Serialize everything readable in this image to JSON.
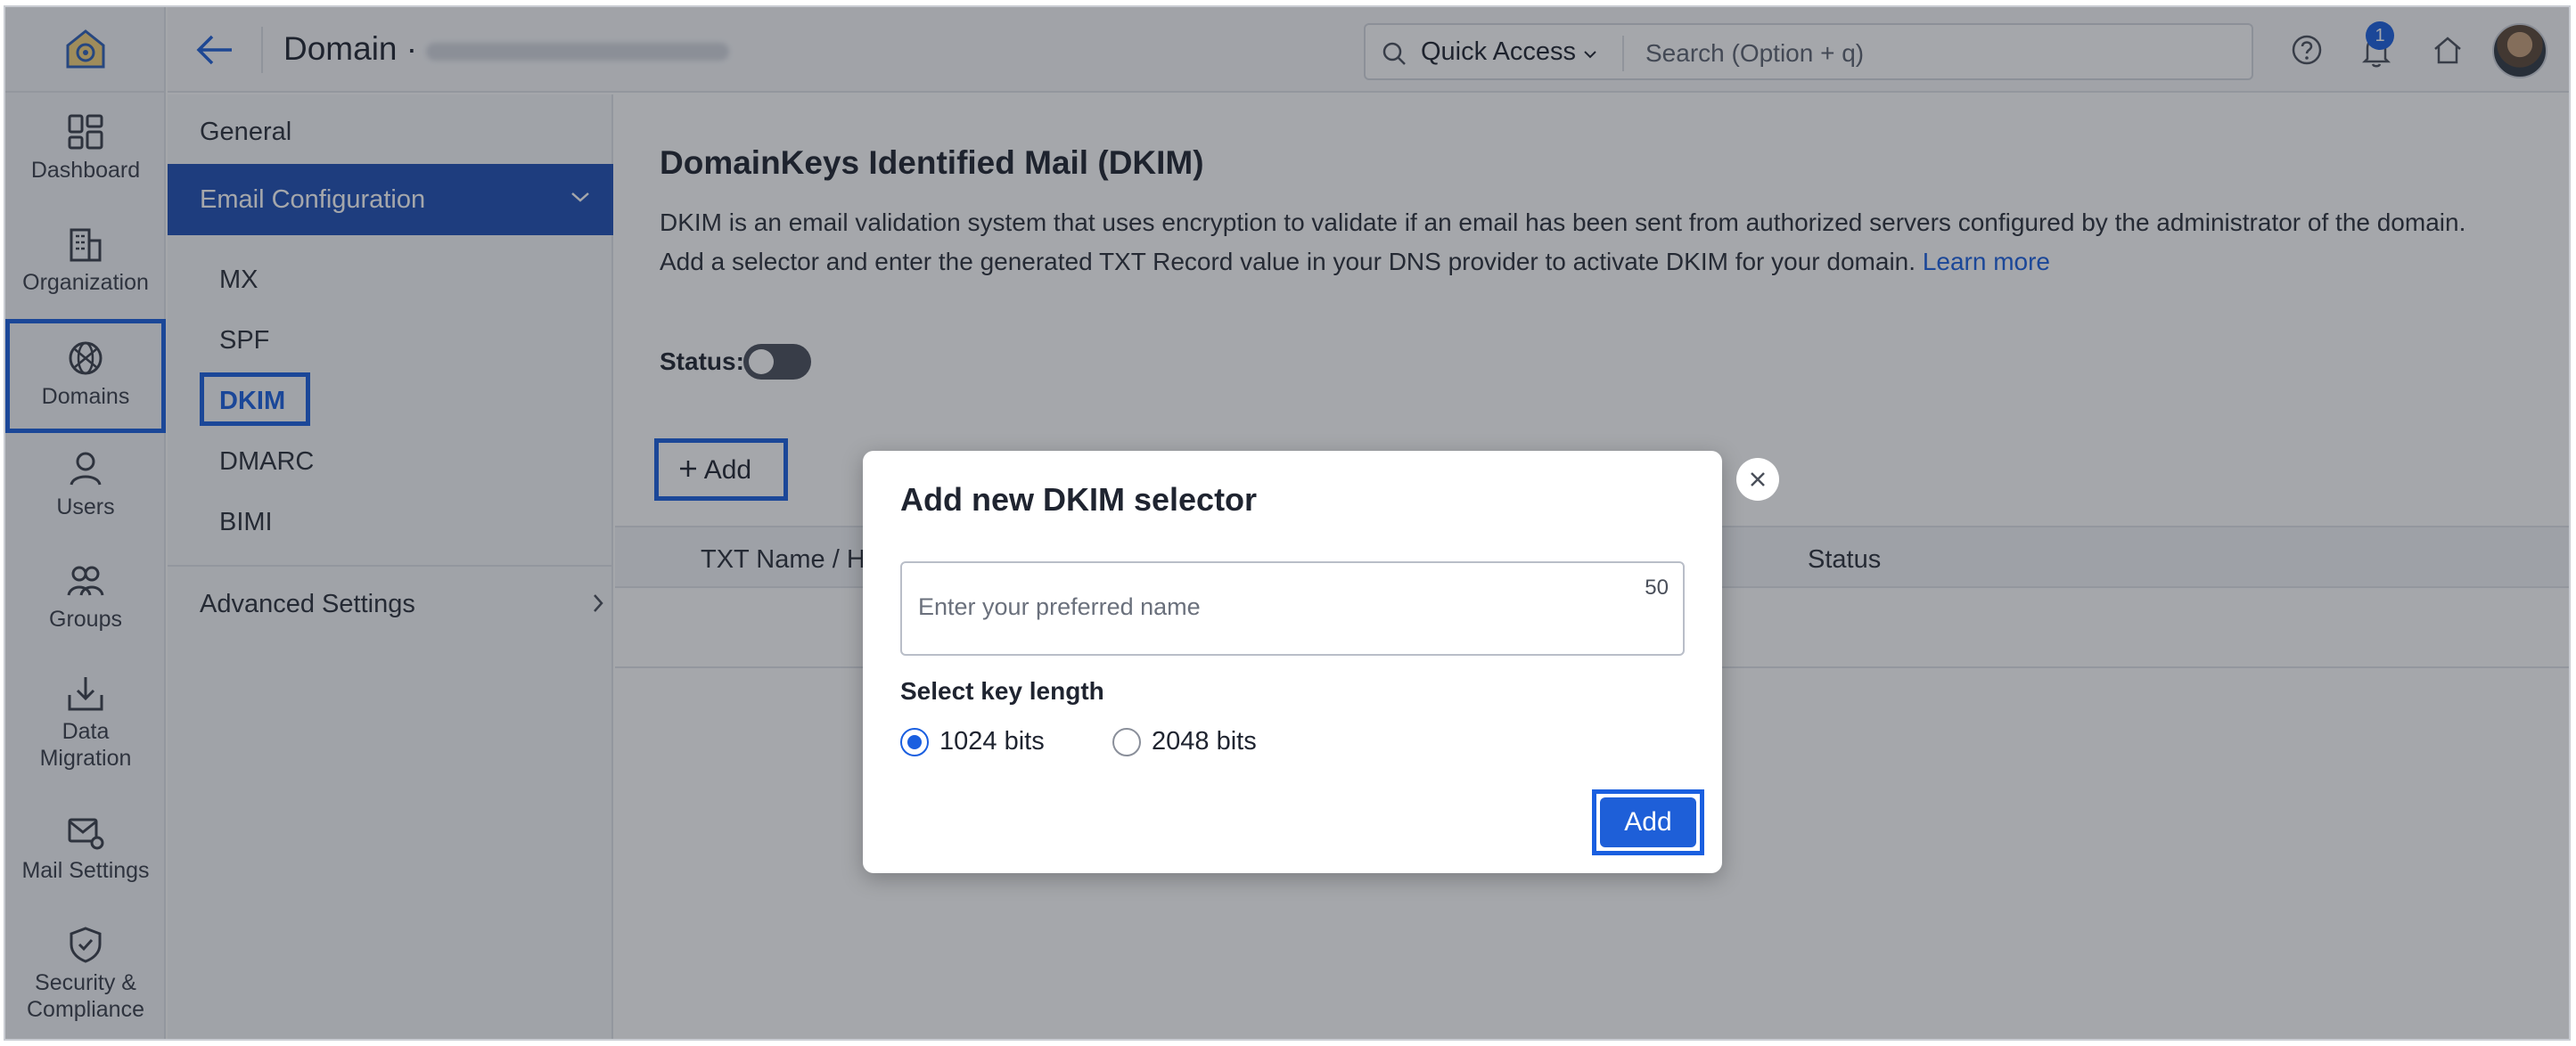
{
  "rail": {
    "items": [
      {
        "label": "Dashboard"
      },
      {
        "label": "Organization"
      },
      {
        "label": "Domains"
      },
      {
        "label": "Users"
      },
      {
        "label": "Groups"
      },
      {
        "label": "Data Migration"
      },
      {
        "label": "Mail Settings"
      },
      {
        "label": "Security & Compliance"
      }
    ]
  },
  "topbar": {
    "title": "Domain ·",
    "quick_access": "Quick Access",
    "search_placeholder": "Search (Option + q)",
    "notification_count": "1"
  },
  "subnav": {
    "general": "General",
    "email_configuration": "Email Configuration",
    "children": [
      "MX",
      "SPF",
      "DKIM",
      "DMARC",
      "BIMI"
    ],
    "advanced_settings": "Advanced Settings"
  },
  "main": {
    "title": "DomainKeys Identified Mail (DKIM)",
    "desc_line1": "DKIM is an email validation system that uses encryption to validate if an email has been sent from authorized servers configured by the administrator of the domain.",
    "desc_line2": "Add a selector and enter the generated TXT Record value in your DNS provider to activate DKIM for your domain.",
    "learn_more": "Learn more",
    "status_label": "Status:",
    "add_label": "Add",
    "col_txt_name": "TXT Name / H",
    "col_status": "Status"
  },
  "modal": {
    "title": "Add new DKIM selector",
    "input_placeholder": "Enter your preferred name",
    "char_limit": "50",
    "key_length_label": "Select key length",
    "options": [
      {
        "label": "1024 bits",
        "selected": true
      },
      {
        "label": "2048 bits",
        "selected": false
      }
    ],
    "submit_label": "Add"
  },
  "colors": {
    "accent": "#1a5fe0",
    "active_nav": "#1e4fb5"
  }
}
